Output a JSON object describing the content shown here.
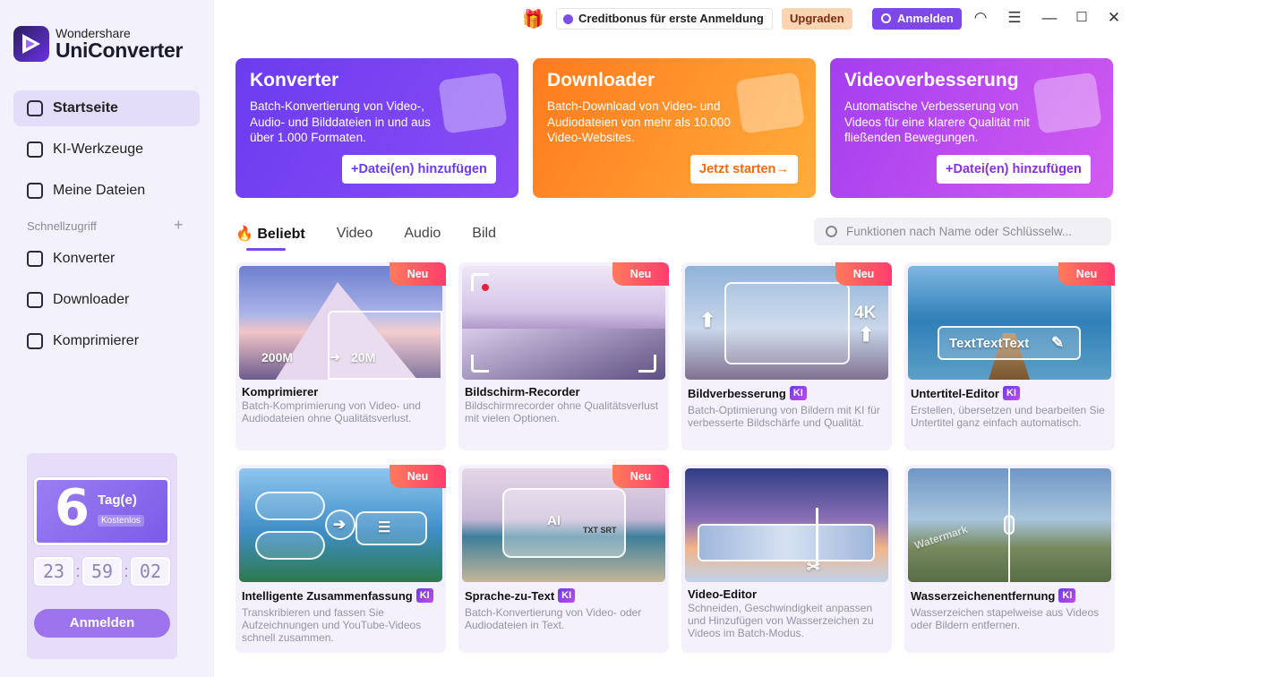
{
  "app": {
    "brand": "Wondershare",
    "name": "UniConverter"
  },
  "sidebar": {
    "items": [
      {
        "label": "Startseite",
        "icon": "home-icon"
      },
      {
        "label": "KI-Werkzeuge",
        "icon": "ai-tools-icon"
      },
      {
        "label": "Meine Dateien",
        "icon": "files-icon"
      }
    ],
    "quick_access_label": "Schnellzugriff",
    "quick_items": [
      {
        "label": "Konverter",
        "icon": "converter-icon"
      },
      {
        "label": "Downloader",
        "icon": "downloader-icon"
      },
      {
        "label": "Komprimierer",
        "icon": "compressor-icon"
      }
    ],
    "trial": {
      "days": "6",
      "unit": "Tag(e)",
      "free": "Kostenlos",
      "hours": "23",
      "minutes": "59",
      "seconds": "02",
      "login_label": "Anmelden"
    }
  },
  "topbar": {
    "credit_label": "Creditbonus für erste Anmeldung",
    "upgrade_label": "Upgraden",
    "login_label": "Anmelden"
  },
  "feature_cards": [
    {
      "title": "Konverter",
      "description": "Batch-Konvertierung von Video-, Audio- und Bilddateien in und aus über 1.000 Formaten.",
      "button": "Datei(en) hinzufügen"
    },
    {
      "title": "Downloader",
      "description": "Batch-Download von Video- und Audiodateien von mehr als 10.000 Video-Websites.",
      "button": "Jetzt starten"
    },
    {
      "title": "Videoverbesserung",
      "description": "Automatische Verbesserung von Videos für eine klarere Qualität mit fließenden Bewegungen.",
      "button": "Datei(en) hinzufügen"
    }
  ],
  "tabs": [
    "Beliebt",
    "Video",
    "Audio",
    "Bild"
  ],
  "search": {
    "placeholder": "Funktionen nach Name oder Schlüsselw..."
  },
  "tools": [
    {
      "title": "Komprimierer",
      "ki": "",
      "badge": "Neu",
      "description": "Batch-Komprimierung von Video- und Audiodateien ohne Qualitätsverlust.",
      "overlay_a": "200M",
      "overlay_b": "20M"
    },
    {
      "title": "Bildschirm-Recorder",
      "ki": "",
      "badge": "Neu",
      "description": "Bildschirmrecorder ohne Qualitätsverlust mit vielen Optionen."
    },
    {
      "title": "Bildverbesserung",
      "ki": "KI",
      "badge": "Neu",
      "description": "Batch-Optimierung von Bildern mit KI für verbesserte Bildschärfe und Qualität.",
      "overlay_a": "4K"
    },
    {
      "title": "Untertitel-Editor",
      "ki": "KI",
      "badge": "Neu",
      "description": "Erstellen, übersetzen und bearbeiten Sie Untertitel ganz einfach automatisch.",
      "overlay_a": "TextTextText"
    },
    {
      "title": "Intelligente Zusammenfassung",
      "ki": "KI",
      "badge": "Neu",
      "description": "Transkribieren und fassen Sie Aufzeichnungen und YouTube-Videos schnell zusammen."
    },
    {
      "title": "Sprache-zu-Text",
      "ki": "KI",
      "badge": "Neu",
      "description": "Batch-Konvertierung von Video- oder Audiodateien in Text.",
      "overlay_a": "AI",
      "overlay_b": "TXT SRT"
    },
    {
      "title": "Video-Editor",
      "ki": "",
      "badge": "",
      "description": "Schneiden, Geschwindigkeit anpassen und Hinzufügen von Wasserzeichen zu Videos im Batch-Modus."
    },
    {
      "title": "Wasserzeichenentfernung",
      "ki": "KI",
      "badge": "",
      "description": "Wasserzeichen stapelweise aus Videos oder Bildern entfernen.",
      "overlay_a": "Watermark"
    }
  ]
}
